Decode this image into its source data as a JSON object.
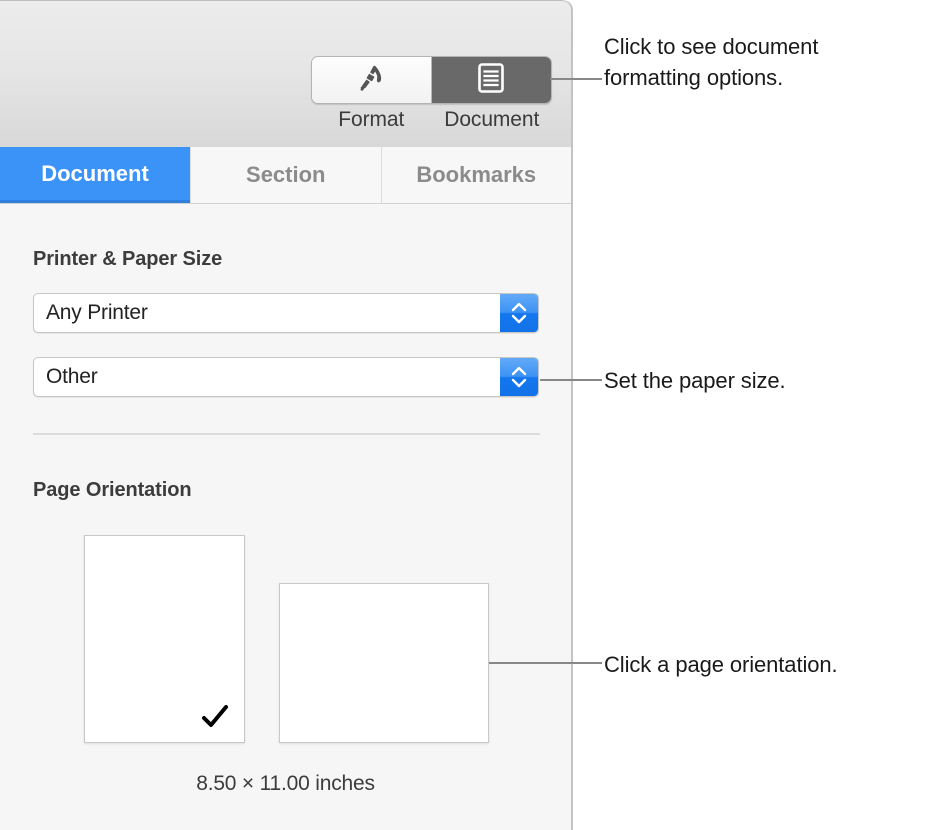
{
  "inspector": {
    "toolbar": {
      "segments": [
        {
          "label": "Format",
          "icon": "paintbrush-icon",
          "selected": false
        },
        {
          "label": "Document",
          "icon": "document-icon",
          "selected": true
        }
      ]
    },
    "tabs": [
      {
        "label": "Document",
        "selected": true
      },
      {
        "label": "Section",
        "selected": false
      },
      {
        "label": "Bookmarks",
        "selected": false
      }
    ],
    "printer_section": {
      "heading": "Printer & Paper Size",
      "printer_popup": {
        "value": "Any Printer",
        "stepper_icon": "up-down-chevron-icon"
      },
      "paper_size_popup": {
        "value": "Other",
        "stepper_icon": "up-down-chevron-icon"
      }
    },
    "orientation_section": {
      "heading": "Page Orientation",
      "options": [
        {
          "name": "portrait",
          "selected": true,
          "check_icon": "checkmark-icon"
        },
        {
          "name": "landscape",
          "selected": false
        }
      ],
      "dimensions": "8.50 × 11.00 inches"
    }
  },
  "callouts": [
    {
      "text": "Click to see document formatting options."
    },
    {
      "text": "Set the paper size."
    },
    {
      "text": "Click a page orientation."
    }
  ],
  "colors": {
    "accent_blue": "#3b93f7",
    "stepper_blue": "#1477ee",
    "active_segment": "#696969",
    "panel_bg": "#f6f6f6"
  }
}
